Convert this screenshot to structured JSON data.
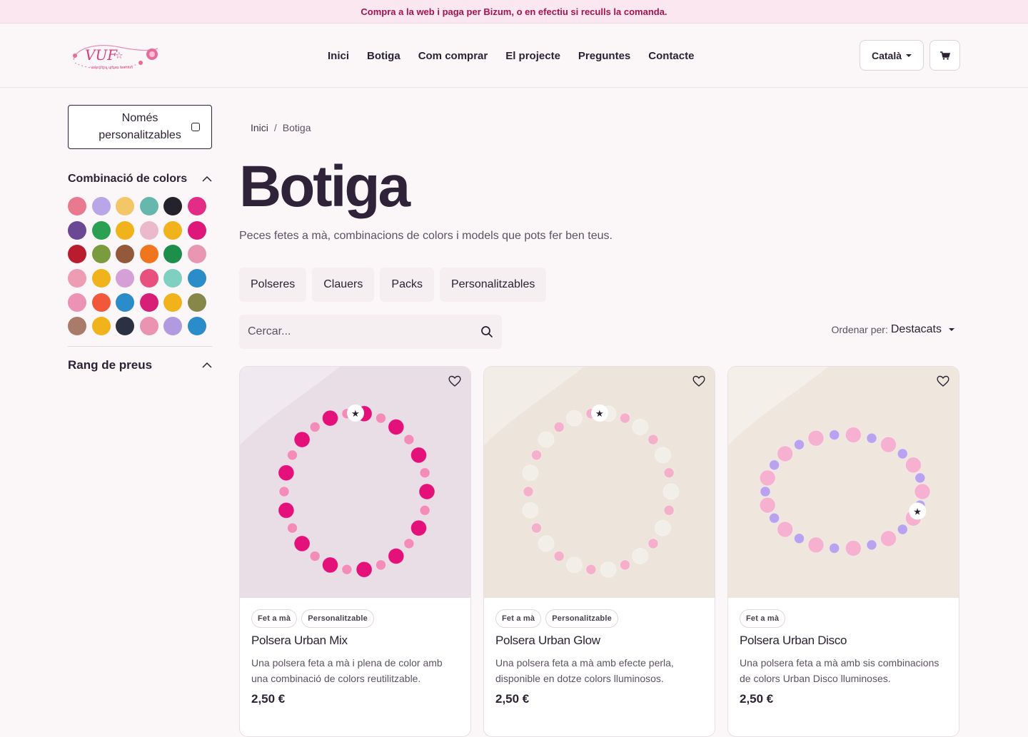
{
  "announcement": "Compra a la web i paga per Bizum, o en efectiu si reculls la comanda.",
  "logo": {
    "text": "VUF",
    "tagline": "valentina urban fashion"
  },
  "nav": [
    "Inici",
    "Botiga",
    "Com comprar",
    "El projecte",
    "Preguntes",
    "Contacte"
  ],
  "language": "Català",
  "sidebar": {
    "only_custom": "Només personalitzables",
    "colors_title": "Combinació de colors",
    "swatches": [
      "#e8798f",
      "#b8a6e8",
      "#f3c667",
      "#67b7ae",
      "#24222a",
      "#e32c86",
      "#6c4793",
      "#2aa152",
      "#f0b31b",
      "#eab9cc",
      "#f0b31b",
      "#e0177a",
      "#b81c2e",
      "#7a9b3e",
      "#93593a",
      "#f1741f",
      "#1d8f4a",
      "#e996b2",
      "#ee9bb4",
      "#f0b31b",
      "#d4a0d6",
      "#e8517f",
      "#7fd0c1",
      "#2a8cc9",
      "#ec92b5",
      "#f1573b",
      "#2a8cc9",
      "#d81f78",
      "#f0b31b",
      "#88874a",
      "#a97b6a",
      "#f0b31b",
      "#2b3140",
      "#eb94b2",
      "#b19ae0",
      "#2a8cc9"
    ],
    "price_title": "Rang de preus"
  },
  "breadcrumb": {
    "home": "Inici",
    "sep": "/",
    "current": "Botiga"
  },
  "page_title": "Botiga",
  "subtitle": "Peces fetes a mà, combinacions de colors i models que pots fer ben teus.",
  "categories": [
    "Polseres",
    "Clauers",
    "Packs",
    "Personalitzables"
  ],
  "search": {
    "placeholder": "Cercar..."
  },
  "sort": {
    "label": "Ordenar per:",
    "value": "Destacats"
  },
  "products": [
    {
      "badges": [
        "Fet a mà",
        "Personalitzable"
      ],
      "name": "Polsera Urban Mix",
      "desc": "Una polsera feta a mà i plena de color amb una combinació de colors reutilitzable.",
      "price": "2,50 €",
      "bg": "#e9dde6",
      "bead1": "#e5117a",
      "bead2": "#f38cb9"
    },
    {
      "badges": [
        "Fet a mà",
        "Personalitzable"
      ],
      "name": "Polsera Urban Glow",
      "desc": "Una polsera feta a mà amb efecte perla, disponible en dotze colors lluminosos.",
      "price": "2,50 €",
      "bg": "#ede4dc",
      "bead1": "#f2eee8",
      "bead2": "#f4b0cb"
    },
    {
      "badges": [
        "Fet a mà"
      ],
      "name": "Polsera Urban Disco",
      "desc": "Una polsera feta a mà amb sis combinacions de colors Urban Disco lluminoses.",
      "price": "2,50 €",
      "bg": "#efe6de",
      "bead1": "#f6b1d0",
      "bead2": "#b9a2ef"
    }
  ]
}
